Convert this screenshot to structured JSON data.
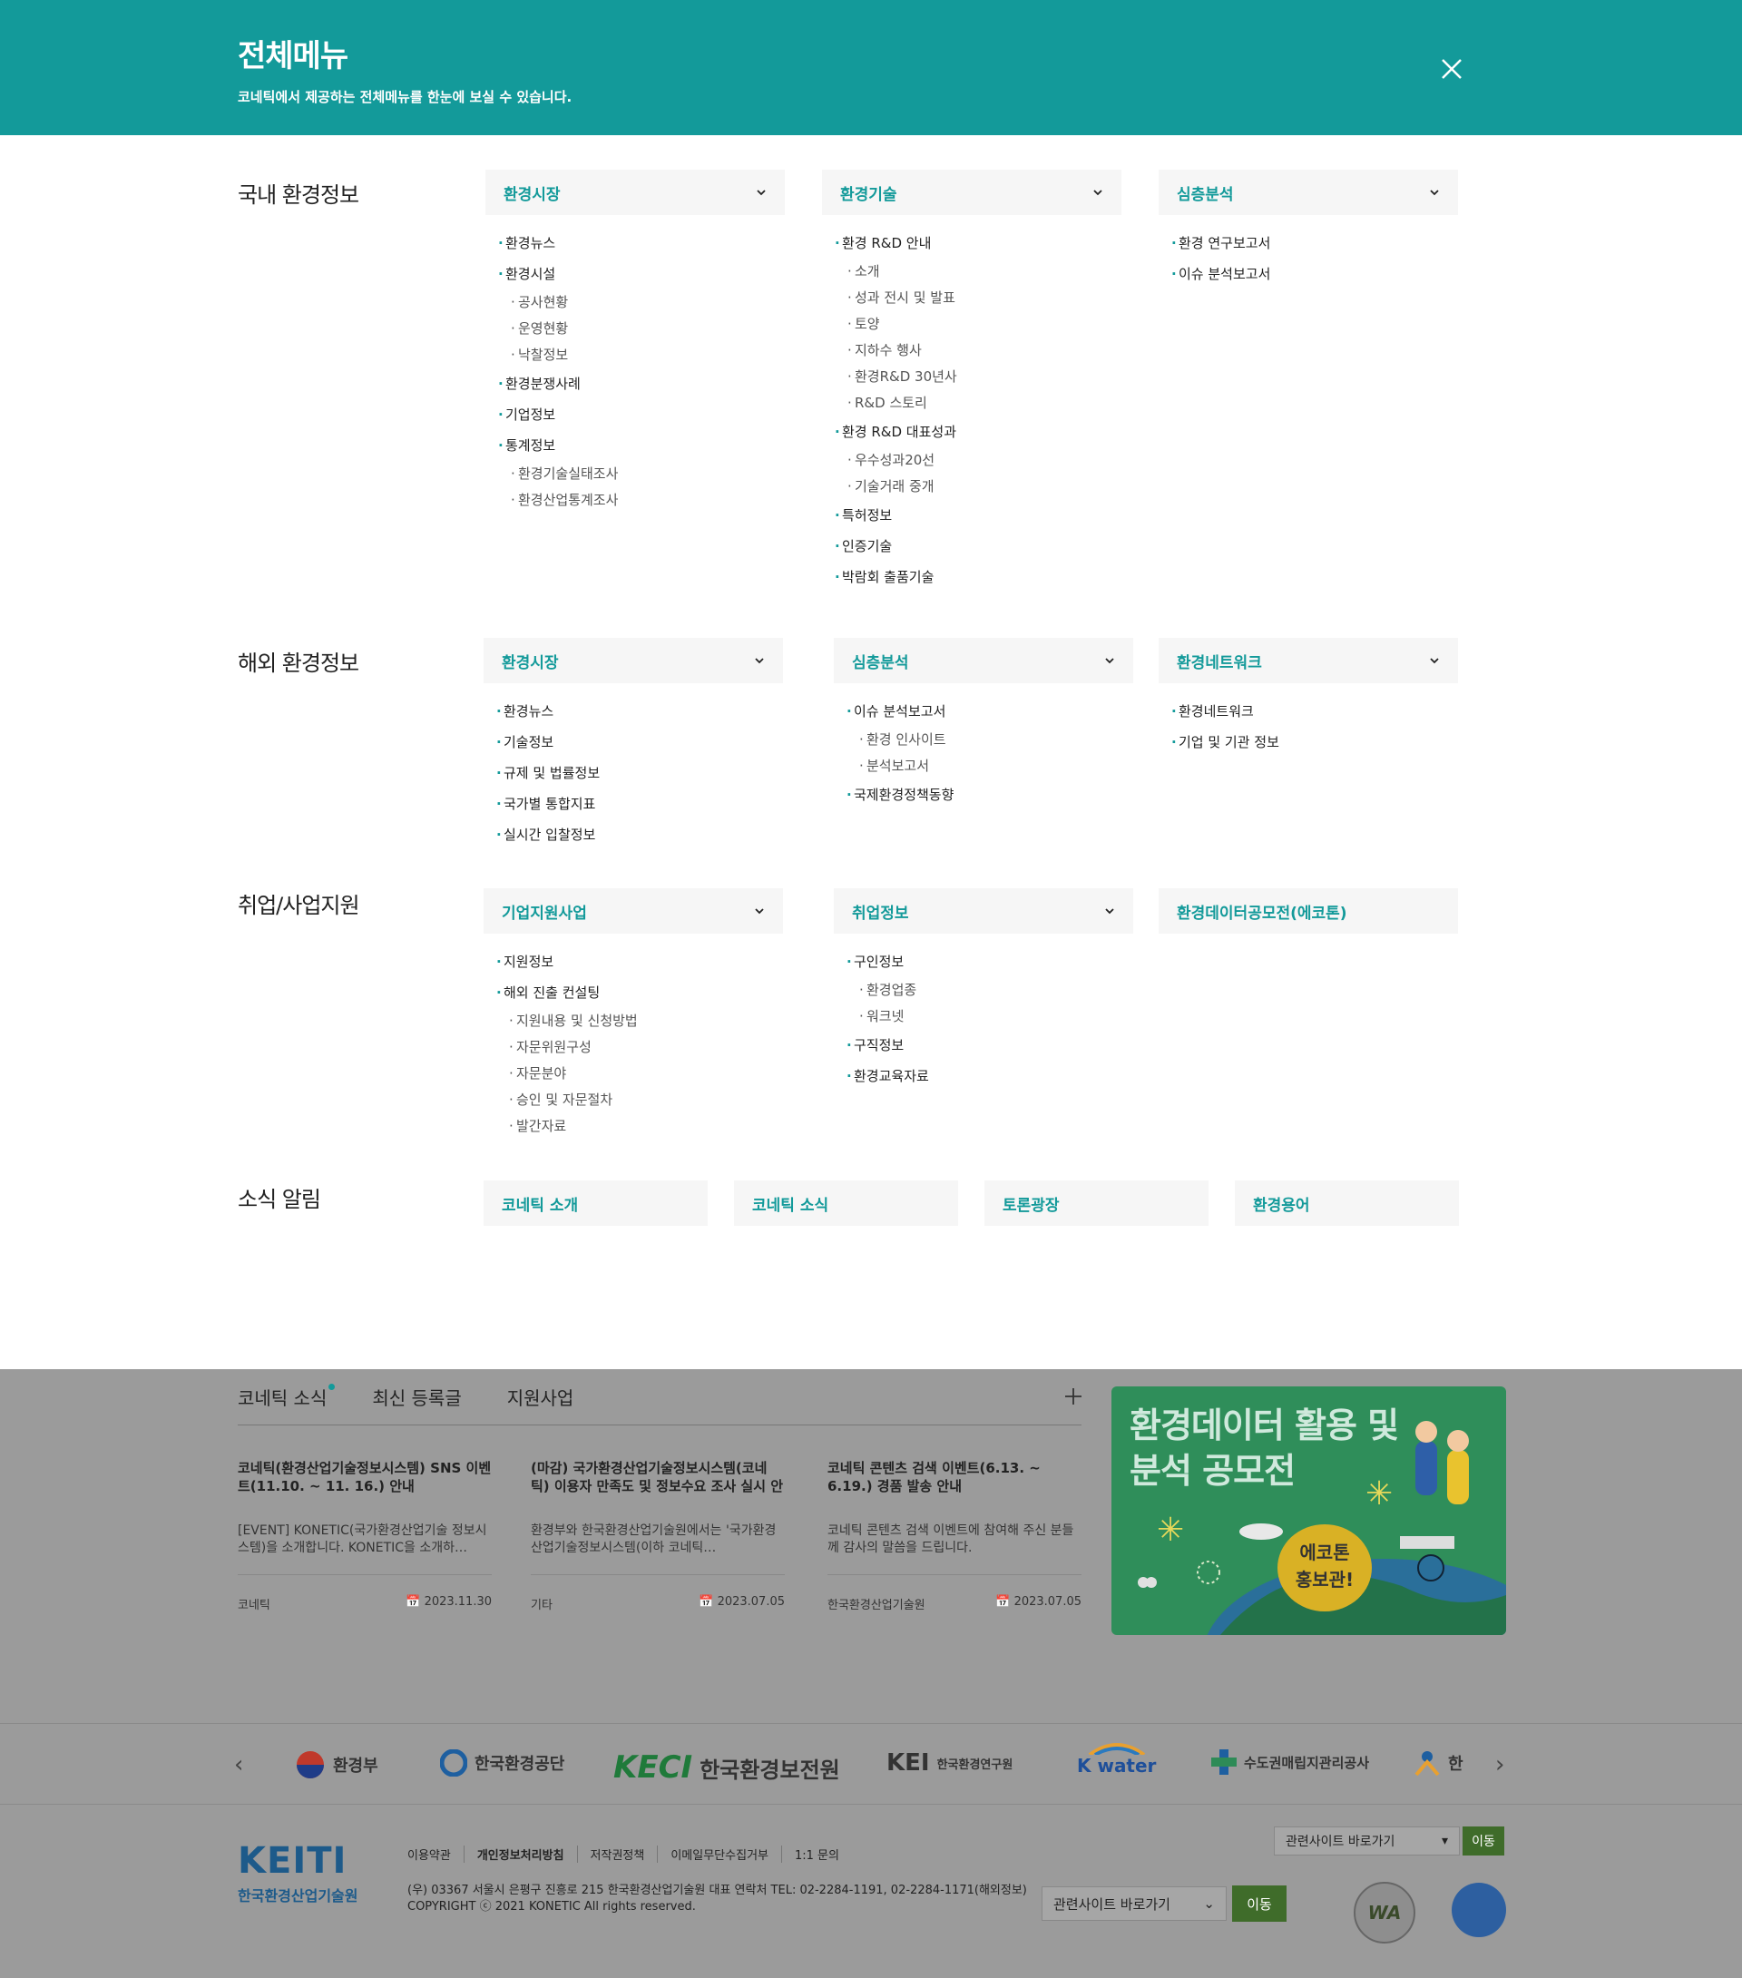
{
  "header": {
    "title": "전체메뉴",
    "description": "코네틱에서 제공하는 전체메뉴를 한눈에 보실 수 있습니다."
  },
  "domestic": {
    "title": "국내 환경정보",
    "cat1": {
      "label": "환경시장",
      "items": [
        {
          "label": "환경뉴스",
          "level": 1
        },
        {
          "label": "환경시설",
          "level": 1
        },
        {
          "label": "공사현황",
          "level": 2
        },
        {
          "label": "운영현황",
          "level": 2
        },
        {
          "label": "낙찰정보",
          "level": 2
        },
        {
          "label": "환경분쟁사례",
          "level": 1
        },
        {
          "label": "기업정보",
          "level": 1
        },
        {
          "label": "통계정보",
          "level": 1
        },
        {
          "label": "환경기술실태조사",
          "level": 2
        },
        {
          "label": "환경산업통계조사",
          "level": 2
        }
      ]
    },
    "cat2": {
      "label": "환경기술",
      "items": [
        {
          "label": "환경 R&D 안내",
          "level": 1
        },
        {
          "label": "소개",
          "level": 2
        },
        {
          "label": "성과 전시 및 발표",
          "level": 2
        },
        {
          "label": "토양",
          "level": 2
        },
        {
          "label": "지하수 행사",
          "level": 2
        },
        {
          "label": "환경R&D 30년사",
          "level": 2
        },
        {
          "label": "R&D 스토리",
          "level": 2
        },
        {
          "label": "환경 R&D 대표성과",
          "level": 1
        },
        {
          "label": "우수성과20선",
          "level": 2
        },
        {
          "label": "기술거래 중개",
          "level": 2
        },
        {
          "label": "특허정보",
          "level": 1
        },
        {
          "label": "인증기술",
          "level": 1
        },
        {
          "label": "박람회 출품기술",
          "level": 1
        }
      ]
    },
    "cat3": {
      "label": "심층분석",
      "items": [
        {
          "label": "환경 연구보고서",
          "level": 1
        },
        {
          "label": "이슈 분석보고서",
          "level": 1
        }
      ]
    }
  },
  "overseas": {
    "title": "해외 환경정보",
    "cat1": {
      "label": "환경시장",
      "items": [
        {
          "label": "환경뉴스",
          "level": 1
        },
        {
          "label": "기술정보",
          "level": 1
        },
        {
          "label": "규제 및 법률정보",
          "level": 1
        },
        {
          "label": "국가별 통합지표",
          "level": 1
        },
        {
          "label": "실시간 입찰정보",
          "level": 1
        }
      ]
    },
    "cat2": {
      "label": "심층분석",
      "items": [
        {
          "label": "이슈 분석보고서",
          "level": 1
        },
        {
          "label": "환경 인사이트",
          "level": 2
        },
        {
          "label": "분석보고서",
          "level": 2
        },
        {
          "label": "국제환경정책동향",
          "level": 1
        }
      ]
    },
    "cat3": {
      "label": "환경네트워크",
      "items": [
        {
          "label": "환경네트워크",
          "level": 1
        },
        {
          "label": "기업 및 기관 정보",
          "level": 1
        }
      ]
    }
  },
  "jobs": {
    "title": "취업/사업지원",
    "cat1": {
      "label": "기업지원사업",
      "items": [
        {
          "label": "지원정보",
          "level": 1
        },
        {
          "label": "해외 진출 컨설팅",
          "level": 1
        },
        {
          "label": "지원내용 및 신청방법",
          "level": 2
        },
        {
          "label": "자문위원구성",
          "level": 2
        },
        {
          "label": "자문분야",
          "level": 2
        },
        {
          "label": "승인 및 자문절차",
          "level": 2
        },
        {
          "label": "발간자료",
          "level": 2
        }
      ]
    },
    "cat2": {
      "label": "취업정보",
      "items": [
        {
          "label": "구인정보",
          "level": 1
        },
        {
          "label": "환경업종",
          "level": 2
        },
        {
          "label": "워크넷",
          "level": 2
        },
        {
          "label": "구직정보",
          "level": 1
        },
        {
          "label": "환경교육자료",
          "level": 1
        }
      ]
    },
    "cat3": {
      "label": "환경데이터공모전(에코톤)"
    }
  },
  "news_section": {
    "title": "소식 알림",
    "buttons": [
      "코네틱 소개",
      "코네틱 소식",
      "토론광장",
      "환경용어"
    ]
  },
  "board": {
    "tabs": [
      "코네틱 소식",
      "최신 등록글",
      "지원사업"
    ],
    "cards": [
      {
        "title": "코네틱(환경산업기술정보시스템) SNS 이벤트(11.10. ~ 11. 16.) 안내",
        "desc": "[EVENT] KONETIC(국가환경산업기술 정보시스템)을 소개합니다. KONETIC을 소개하…",
        "author": "코네틱",
        "date": "2023.11.30"
      },
      {
        "title": "(마감) 국가환경산업기술정보시스템(코네틱) 이용자 만족도 및 정보수요 조사 실시 안내",
        "desc": "환경부와 한국환경산업기술원에서는 '국가환경산업기술정보시스템(이하 코네틱…",
        "author": "기타",
        "date": "2023.07.05"
      },
      {
        "title": "코네틱 콘텐츠 검색 이벤트(6.13. ~ 6.19.) 경품 발송 안내",
        "desc": "코네틱 콘텐츠 검색 이벤트에 참여해 주신 분들께 감사의 말씀을 드립니다.",
        "author": "한국환경산업기술원",
        "date": "2023.07.05"
      }
    ],
    "banner": {
      "title_line1": "환경데이터 활용 및",
      "title_line2": "분석 공모전",
      "bubble_line1": "에코톤",
      "bubble_line2": "홍보관!"
    }
  },
  "partners": [
    "환경부",
    "한국환경공단",
    "한국환경보전원",
    "한국환경연구원",
    "K water",
    "수도권매립지관리공사",
    "한"
  ],
  "footer": {
    "logo_text": "KEITI",
    "org_name": "한국환경산업기술원",
    "links": [
      "이용약관",
      "개인정보처리방침",
      "저작권정책",
      "이메일무단수집거부",
      "1:1 문의"
    ],
    "address": "(우) 03367 서울시 은평구 진흥로 215 한국환경산업기술원 대표 연락처 TEL: 02-2284-1191, 02-2284-1171(해외정보)",
    "copyright": "COPYRIGHT ⓒ 2021 KONETIC All rights reserved.",
    "site_select": "관련사이트 바로가기",
    "go_button": "이동",
    "wa_label": "WA"
  },
  "colors": {
    "accent": "#139a9a",
    "go_button": "#3f6c2a"
  }
}
